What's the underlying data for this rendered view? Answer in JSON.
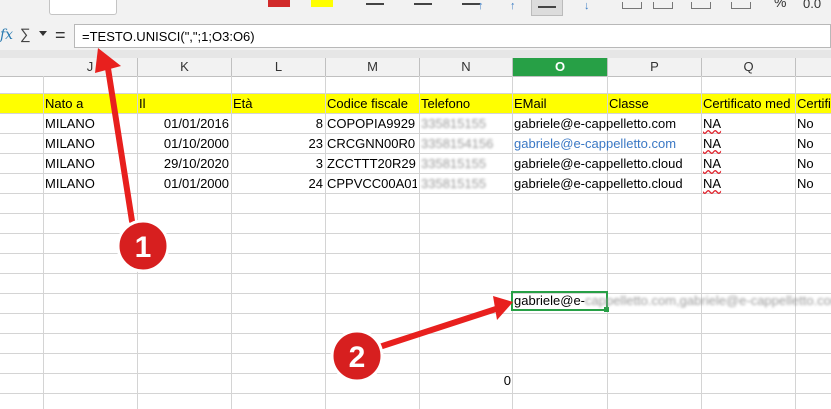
{
  "toolbar": {},
  "formula": {
    "value": "=TESTO.UNISCI(\",\";1;O3:O6)"
  },
  "columns": [
    "J",
    "K",
    "L",
    "M",
    "N",
    "O",
    "P",
    "Q",
    ""
  ],
  "active_column": "O",
  "header_row": [
    "Nato a",
    "Il",
    "Età",
    "Codice fiscale",
    "Telefono",
    "EMail",
    "Classe",
    "Certificato med",
    "Certifi"
  ],
  "rows": [
    [
      "MILANO",
      "01/01/2016",
      "8",
      "COPOPIA9929",
      "335815155",
      "gabriele@e-cappelletto.com",
      "",
      "NA",
      "No"
    ],
    [
      "MILANO",
      "01/10/2000",
      "23",
      "CRCGNN00R0",
      "3358154156",
      "gabriele@e-cappelletto.com",
      "",
      "NA",
      "No"
    ],
    [
      "MILANO",
      "29/10/2020",
      "3",
      "ZCCTTT20R29",
      "335815155",
      "gabriele@e-cappelletto.cloud",
      "",
      "NA",
      "No"
    ],
    [
      "MILANO",
      "01/01/2000",
      "24",
      "CPPVCC00A01",
      "335815155",
      "gabriele@e-cappelletto.cloud",
      "",
      "NA",
      "No"
    ]
  ],
  "result_cell": {
    "value_clear": "gabriele@e-",
    "value_blurred": "cappelletto.com,gabriele@e-cappelletto.com"
  },
  "zero_cell": "0",
  "callouts": [
    "1",
    "2"
  ],
  "colors": {
    "annotation": "#e8201e",
    "active": "#27a046",
    "header_fill": "#ffff00"
  }
}
